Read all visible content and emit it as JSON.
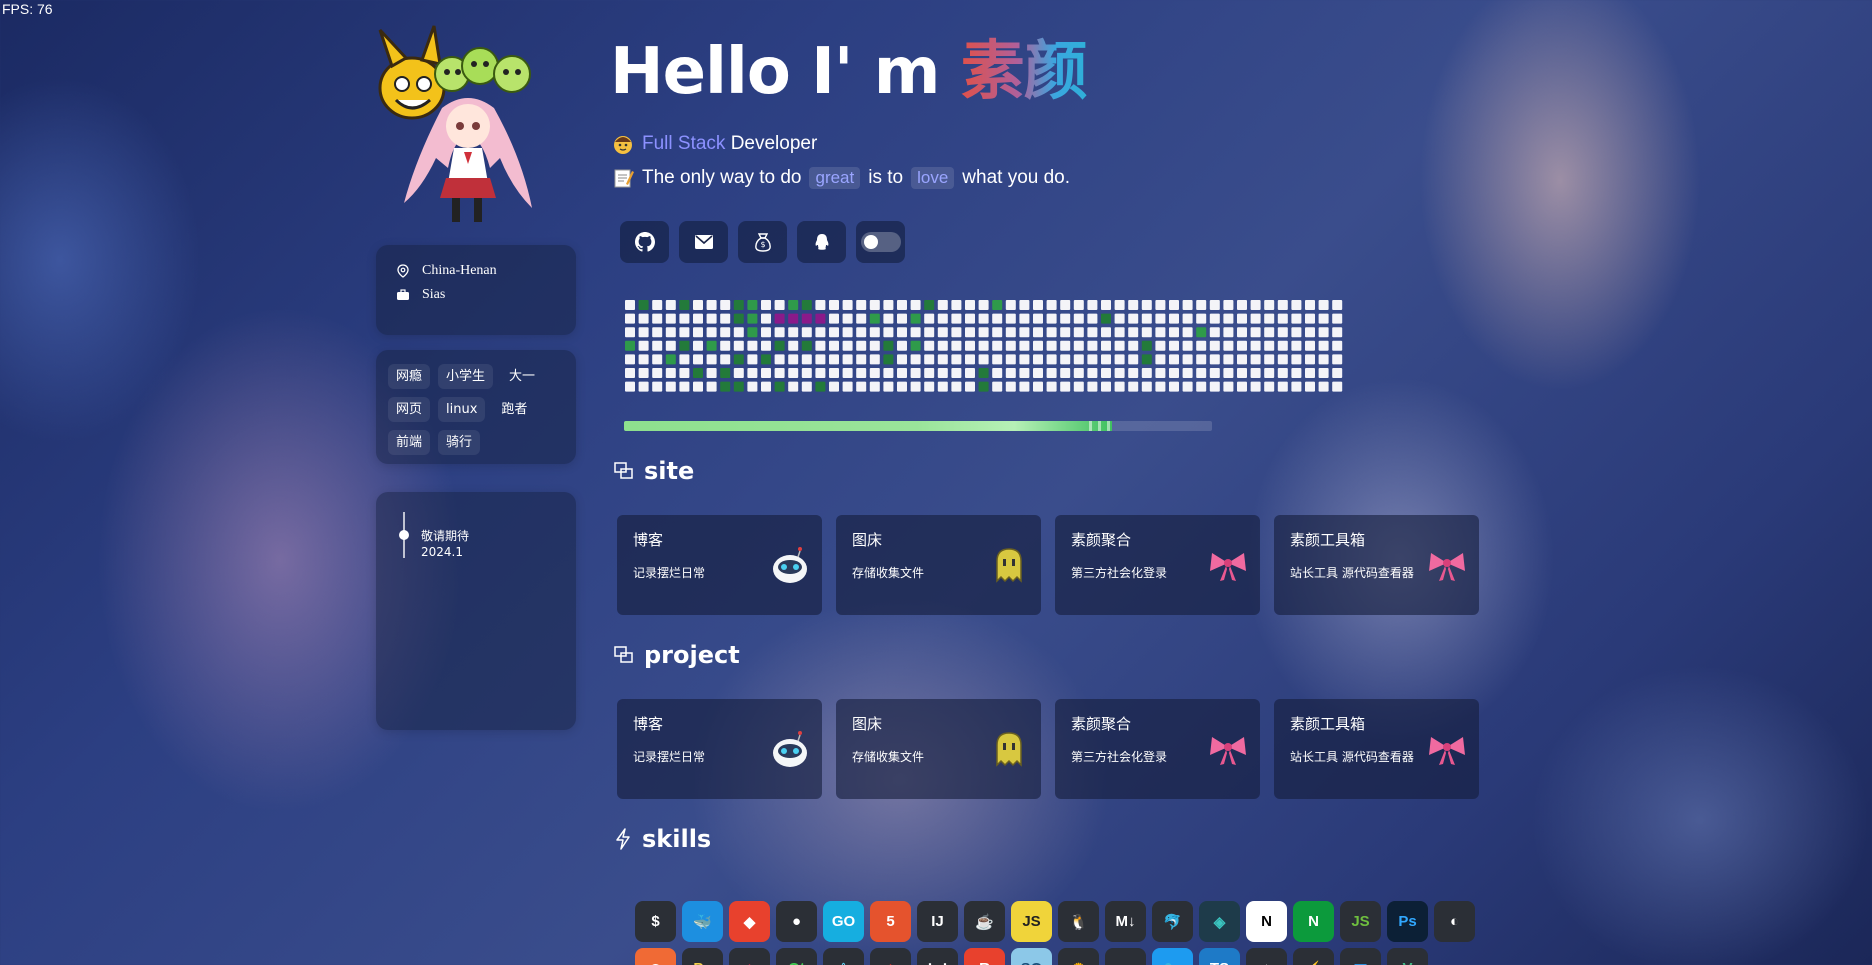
{
  "fps": "FPS: 76",
  "hero": {
    "greeting": "Hello I' m ",
    "name": "素颜"
  },
  "intro": {
    "line1_hl": "Full Stack",
    "line1_rest": " Developer",
    "line2_a": "The only way to do",
    "line2_code1": "great",
    "line2_b": "is to",
    "line2_code2": "love",
    "line2_c": "what you do."
  },
  "profile": {
    "location": "China-Henan",
    "company": "Sias"
  },
  "tags": [
    "网瘾",
    "小学生",
    "大一",
    "网页",
    "linux",
    "跑者",
    "前端",
    "骑行"
  ],
  "timeline": {
    "title": "敬请期待",
    "date": "2024.1"
  },
  "social": [
    "github-icon",
    "email-icon",
    "money-bag-icon",
    "qq-penguin-icon",
    "theme-toggle"
  ],
  "progress": {
    "fraction": 0.83
  },
  "sections": {
    "site": "site",
    "project": "project",
    "skills": "skills"
  },
  "site_cards": [
    {
      "title": "博客",
      "desc": "记录摆烂日常",
      "icon": "robot-icon"
    },
    {
      "title": "图床",
      "desc": "存储收集文件",
      "icon": "ghost-icon"
    },
    {
      "title": "素颜聚合",
      "desc": "第三方社会化登录",
      "icon": "bow-icon"
    },
    {
      "title": "素颜工具箱",
      "desc": "站长工具 源代码查看器",
      "icon": "bow-icon"
    }
  ],
  "project_cards": [
    {
      "title": "博客",
      "desc": "记录摆烂日常",
      "icon": "robot-icon"
    },
    {
      "title": "图床",
      "desc": "存储收集文件",
      "icon": "ghost-icon"
    },
    {
      "title": "素颜聚合",
      "desc": "第三方社会化登录",
      "icon": "bow-icon"
    },
    {
      "title": "素颜工具箱",
      "desc": "站长工具 源代码查看器",
      "icon": "bow-icon"
    }
  ],
  "skills_row1": [
    {
      "name": "bash-icon",
      "label": "$",
      "bg": "#2b2f36",
      "fg": "#ffffff"
    },
    {
      "name": "docker-icon",
      "label": "🐳",
      "bg": "#1d8fe0",
      "fg": "#ffffff"
    },
    {
      "name": "git-icon",
      "label": "◆",
      "bg": "#e8412d",
      "fg": "#ffffff"
    },
    {
      "name": "github-icon",
      "label": "●",
      "bg": "#2b2f36",
      "fg": "#ffffff"
    },
    {
      "name": "go-icon",
      "label": "GO",
      "bg": "#16aee0",
      "fg": "#ffffff"
    },
    {
      "name": "html5-icon",
      "label": "5",
      "bg": "#e5532d",
      "fg": "#ffffff"
    },
    {
      "name": "idea-icon",
      "label": "IJ",
      "bg": "#2b2f36",
      "fg": "#ffffff"
    },
    {
      "name": "java-icon",
      "label": "☕",
      "bg": "#2b2f36",
      "fg": "#ffffff"
    },
    {
      "name": "js-icon",
      "label": "JS",
      "bg": "#f0d43a",
      "fg": "#222222"
    },
    {
      "name": "linux-icon",
      "label": "🐧",
      "bg": "#2b2f36",
      "fg": "#ffffff"
    },
    {
      "name": "markdown-icon",
      "label": "M↓",
      "bg": "#2b2f36",
      "fg": "#ffffff"
    },
    {
      "name": "mysql-icon",
      "label": "🐬",
      "bg": "#2b2f36",
      "fg": "#ffffff"
    },
    {
      "name": "netlify-icon",
      "label": "◈",
      "bg": "#1e3b4a",
      "fg": "#3bc5c0"
    },
    {
      "name": "nextjs-icon",
      "label": "N",
      "bg": "#ffffff",
      "fg": "#000000"
    },
    {
      "name": "nginx-icon",
      "label": "N",
      "bg": "#0c9a3c",
      "fg": "#ffffff"
    },
    {
      "name": "nodejs-icon",
      "label": "JS",
      "bg": "#2b2f36",
      "fg": "#6fbf3f"
    },
    {
      "name": "photoshop-icon",
      "label": "Ps",
      "bg": "#0c2036",
      "fg": "#31a8ff"
    },
    {
      "name": "planetscale-icon",
      "label": "◐",
      "bg": "#2b2f36",
      "fg": "#ffffff"
    }
  ],
  "skills_row2": [
    {
      "name": "postman-icon",
      "label": "◉",
      "bg": "#f06a35",
      "fg": "#ffffff"
    },
    {
      "name": "python-icon",
      "label": "Py",
      "bg": "#2b2f36",
      "fg": "#f3d04a"
    },
    {
      "name": "raspberry-icon",
      "label": "◆",
      "bg": "#2b2f36",
      "fg": "#c7244c"
    },
    {
      "name": "qt-icon",
      "label": "Qt",
      "bg": "#2b2f36",
      "fg": "#41cd52"
    },
    {
      "name": "react-icon",
      "label": "⚛",
      "bg": "#2b2f36",
      "fg": "#61dafb"
    },
    {
      "name": "redis-icon",
      "label": "◆",
      "bg": "#2b2f36",
      "fg": "#d82c20"
    },
    {
      "name": "dots-icon",
      "label": "⋮⋮",
      "bg": "#2b2f36",
      "fg": "#ffffff"
    },
    {
      "name": "rust-icon",
      "label": "R",
      "bg": "#e8412d",
      "fg": "#ffffff"
    },
    {
      "name": "sqlite-icon",
      "label": "SQ",
      "bg": "#8cc8e8",
      "fg": "#1a4f7a"
    },
    {
      "name": "svelte-icon",
      "label": "✺",
      "bg": "#2b2f36",
      "fg": "#ffb300"
    },
    {
      "name": "tailwind-icon",
      "label": "~",
      "bg": "#2b2f36",
      "fg": "#38bdf8"
    },
    {
      "name": "twitter-icon",
      "label": "🐦",
      "bg": "#1d9bf0",
      "fg": "#ffffff"
    },
    {
      "name": "typescript-icon",
      "label": "TS",
      "bg": "#1e7ac7",
      "fg": "#ffffff"
    },
    {
      "name": "vercel-icon",
      "label": "▲",
      "bg": "#2b2f36",
      "fg": "#ffffff"
    },
    {
      "name": "vite-icon",
      "label": "⚡",
      "bg": "#2b2f36",
      "fg": "#ffc62b"
    },
    {
      "name": "vscode-icon",
      "label": "◥",
      "bg": "#2b2f36",
      "fg": "#2a9df4"
    },
    {
      "name": "vue-icon",
      "label": "V",
      "bg": "#2b2f36",
      "fg": "#41b883"
    }
  ]
}
